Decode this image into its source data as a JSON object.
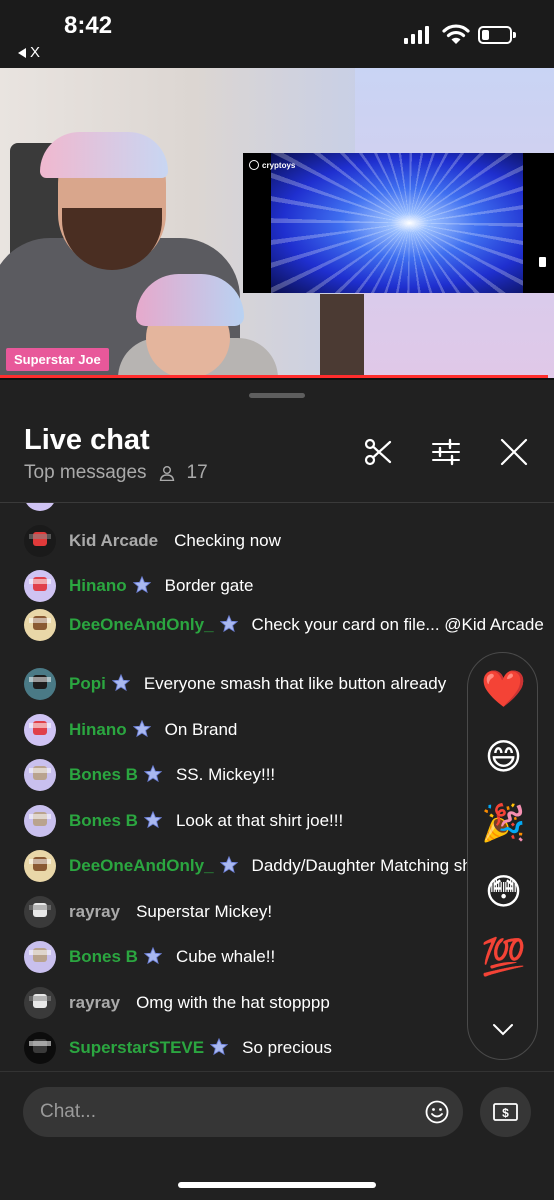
{
  "status_bar": {
    "time": "8:42",
    "back_label": "X",
    "battery_percent": 20
  },
  "video": {
    "presenter_tag": "Superstar Joe",
    "overlay_logo": "cryptoys"
  },
  "chat": {
    "title": "Live chat",
    "mode": "Top messages",
    "viewer_count": "17",
    "messages": [
      {
        "author": "Kid Arcade",
        "text": "Checking now",
        "member": false,
        "avatar_color": "#1a1a1a",
        "accent": "#e03a3a"
      },
      {
        "author": "Hinano",
        "text": "Border gate",
        "member": true,
        "avatar_color": "#cfc3f3",
        "accent": "#e0404a"
      },
      {
        "author": "DeeOneAndOnly_",
        "text": "Check your card on file... @Kid Arcade",
        "member": true,
        "avatar_color": "#e9d7a8",
        "accent": "#8a5a34"
      },
      {
        "author": "Popi",
        "text": "Everyone smash that like button already",
        "member": true,
        "avatar_color": "#4a7a86",
        "accent": "#1c1c1c"
      },
      {
        "author": "Hinano",
        "text": "On Brand",
        "member": true,
        "avatar_color": "#cfc3f3",
        "accent": "#e0404a"
      },
      {
        "author": "Bones B",
        "text": "SS. Mickey!!!",
        "member": true,
        "avatar_color": "#c9c0ee",
        "accent": "#b9a38e"
      },
      {
        "author": "Bones B",
        "text": "Look at that shirt joe!!!",
        "member": true,
        "avatar_color": "#c9c0ee",
        "accent": "#b9a38e"
      },
      {
        "author": "DeeOneAndOnly_",
        "text": "Daddy/Daughter Matching shirts",
        "member": true,
        "avatar_color": "#e9d7a8",
        "accent": "#8a5a34"
      },
      {
        "author": "rayray",
        "text": "Superstar Mickey!",
        "member": false,
        "avatar_color": "#3a3a3a",
        "accent": "#e8e8e8"
      },
      {
        "author": "Bones B",
        "text": "Cube whale!!",
        "member": true,
        "avatar_color": "#c9c0ee",
        "accent": "#b9a38e"
      },
      {
        "author": "rayray",
        "text": "Omg with the hat stopppp",
        "member": false,
        "avatar_color": "#3a3a3a",
        "accent": "#e8e8e8"
      },
      {
        "author": "SuperstarSTEVE",
        "text": "So precious",
        "member": true,
        "avatar_color": "#0c0c0c",
        "accent": "#3a3a3a"
      }
    ],
    "reactions": [
      "❤️",
      "😄",
      "🎉",
      "😳",
      "💯"
    ],
    "input_placeholder": "Chat..."
  }
}
